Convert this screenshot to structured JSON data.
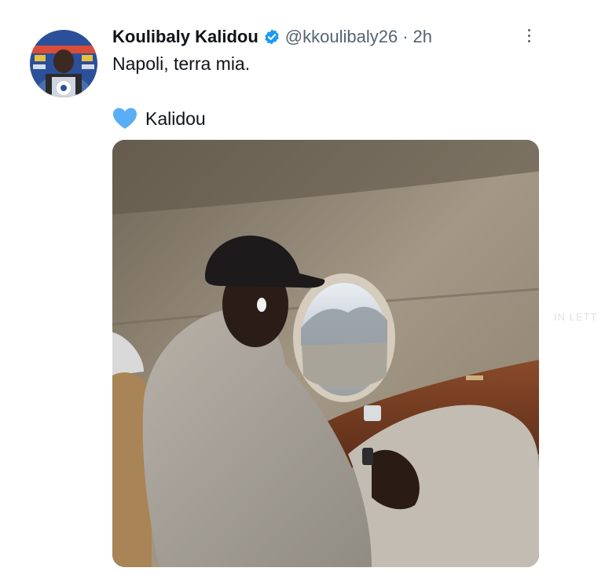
{
  "tweet": {
    "author_name": "Koulibaly Kalidou",
    "handle": "@kkoulibaly26",
    "separator": "·",
    "time": "2h",
    "text": "Napoli, terra mia.",
    "signature_icon": "blue-heart-icon",
    "signature": "Kalidou",
    "verified_icon": "verified-badge-icon",
    "more_icon": "more-options-icon"
  },
  "watermark": "IN LETT",
  "colors": {
    "verified": "#1d9bf0",
    "heart": "#5aaef5",
    "secondary_text": "#536471",
    "primary_text": "#0f1419"
  }
}
